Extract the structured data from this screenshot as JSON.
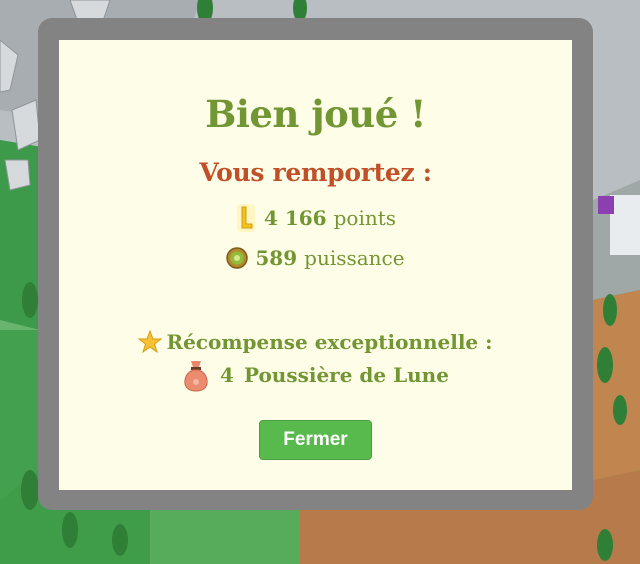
{
  "modal": {
    "title": "Bien joué !",
    "subtitle": "Vous remportez :",
    "rewards": [
      {
        "icon": "gold-l-token-icon",
        "value": "4 166",
        "label": "points"
      },
      {
        "icon": "power-coin-icon",
        "value": "589",
        "label": "puissance"
      }
    ],
    "special": {
      "icon": "star-icon",
      "label": "Récompense exceptionnelle :",
      "item_icon": "moon-dust-bag-icon",
      "item_value": "4",
      "item_label": "Poussière de Lune"
    },
    "close_label": "Fermer"
  },
  "colors": {
    "title": "#729634",
    "subtitle": "#c0502a",
    "panel": "#fefee8",
    "frame": "#838383",
    "button": "#58b94c"
  }
}
